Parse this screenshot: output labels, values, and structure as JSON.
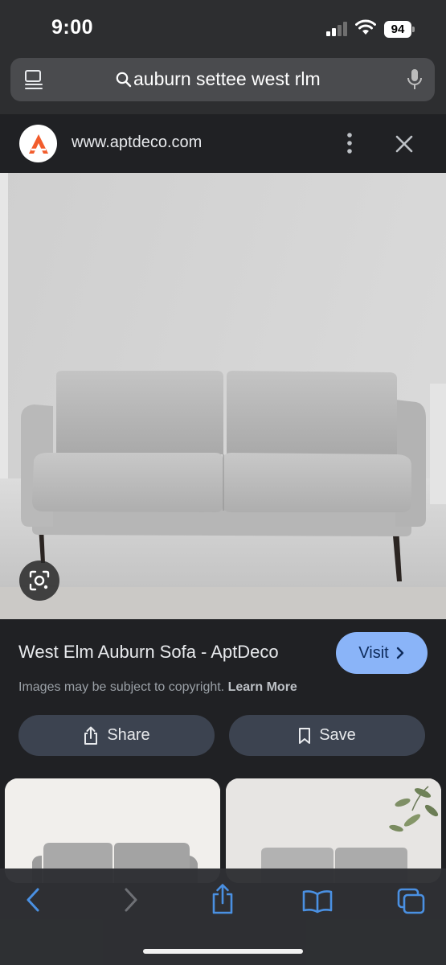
{
  "status_bar": {
    "time": "9:00",
    "battery_level": "94",
    "icons": [
      "signal-icon",
      "wifi-icon",
      "battery-icon"
    ]
  },
  "address_bar": {
    "query": "auburn settee west rlm",
    "icons": [
      "reader-icon",
      "search-icon",
      "mic-icon"
    ]
  },
  "source": {
    "logo_letter": "A",
    "url": "www.aptdeco.com",
    "icons": [
      "more-vertical-icon",
      "close-icon"
    ]
  },
  "result": {
    "title": "West Elm Auburn Sofa - AptDeco",
    "visit_label": "Visit",
    "copyright_text": "Images may be subject to copyright.",
    "learn_more": "Learn More",
    "share_label": "Share",
    "save_label": "Save"
  },
  "toolbar": {
    "icons": [
      "back-icon",
      "forward-icon",
      "share-icon",
      "bookmarks-icon",
      "tabs-icon"
    ]
  },
  "colors": {
    "accent": "#8ab4f8",
    "toolbar_icon": "#4a90e2",
    "logo_orange": "#f25c2c"
  }
}
